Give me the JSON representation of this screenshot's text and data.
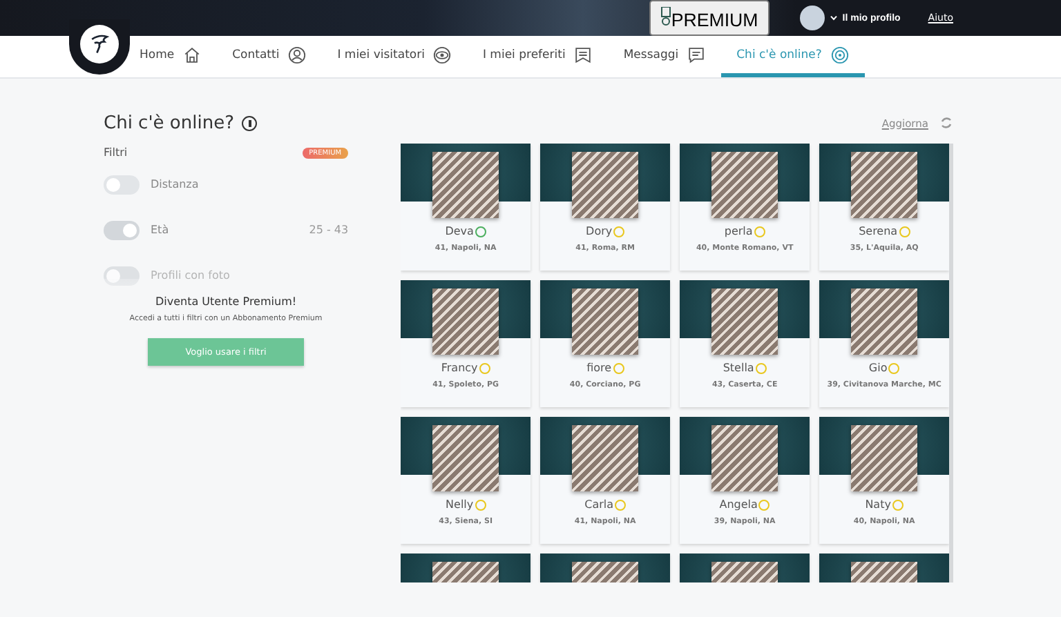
{
  "topbar": {
    "premium_label": "PREMIUM",
    "profile_label": "Il mio profilo",
    "help_link": "Aiuto"
  },
  "nav": [
    {
      "label": "Home",
      "selected": false
    },
    {
      "label": "Contatti",
      "selected": false
    },
    {
      "label": "I miei visitatori",
      "selected": false
    },
    {
      "label": "I miei preferiti",
      "selected": false
    },
    {
      "label": "Messaggi",
      "selected": false
    },
    {
      "label": "Chi c'è online?",
      "selected": true
    }
  ],
  "page": {
    "title": "Chi c'è online?",
    "refresh_link": "Aggiorna"
  },
  "filters": {
    "heading": "Filtri",
    "badge": "PREMIUM",
    "items": [
      {
        "label": "Distanza",
        "on": false,
        "disabled": false
      },
      {
        "label": "Età",
        "on": true,
        "disabled": false,
        "value": "25 - 43"
      },
      {
        "label": "Profili con foto",
        "on": false,
        "disabled": true
      }
    ],
    "promo": {
      "title": "Diventa Utente Premium!",
      "text": "Accedi a tutti i filtri con un Abbonamento Premium",
      "button": "Voglio usare i filtri"
    }
  },
  "profiles": [
    {
      "kind": "full",
      "name": "Deva",
      "color": "#4caf5f",
      "details": "41, Napoli, NA"
    },
    {
      "kind": "full",
      "name": "Dory",
      "color": "#e9c71d",
      "details": "41, Roma, RM"
    },
    {
      "kind": "full",
      "name": "perla",
      "color": "#e9c71d",
      "details": "40, Monte Romano, VT"
    },
    {
      "kind": "full",
      "name": "Serena",
      "color": "#e9c71d",
      "details": "35, L'Aquila, AQ"
    },
    {
      "kind": "full",
      "name": "Francy",
      "color": "#e9c71d",
      "details": "41, Spoleto, PG"
    },
    {
      "kind": "full",
      "name": "fiore",
      "color": "#e9c71d",
      "details": "40, Corciano, PG"
    },
    {
      "kind": "full",
      "name": "Stella",
      "color": "#e9c71d",
      "details": "43, Caserta, CE"
    },
    {
      "kind": "full",
      "name": "Gio",
      "color": "#e9c71d",
      "details": "39, Civitanova Marche, MC"
    },
    {
      "kind": "full",
      "name": "Nelly",
      "color": "#e9c71d",
      "details": "43, Siena, SI"
    },
    {
      "kind": "full",
      "name": "Carla",
      "color": "#e9c71d",
      "details": "41, Napoli, NA"
    },
    {
      "kind": "full",
      "name": "Angela",
      "color": "#e9c71d",
      "details": "39, Napoli, NA"
    },
    {
      "kind": "full",
      "name": "Naty",
      "color": "#e9c71d",
      "details": "40, Napoli, NA"
    },
    {
      "kind": "cut-off"
    },
    {
      "kind": "cut-off"
    },
    {
      "kind": "cut-off"
    },
    {
      "kind": "cut-off"
    }
  ]
}
